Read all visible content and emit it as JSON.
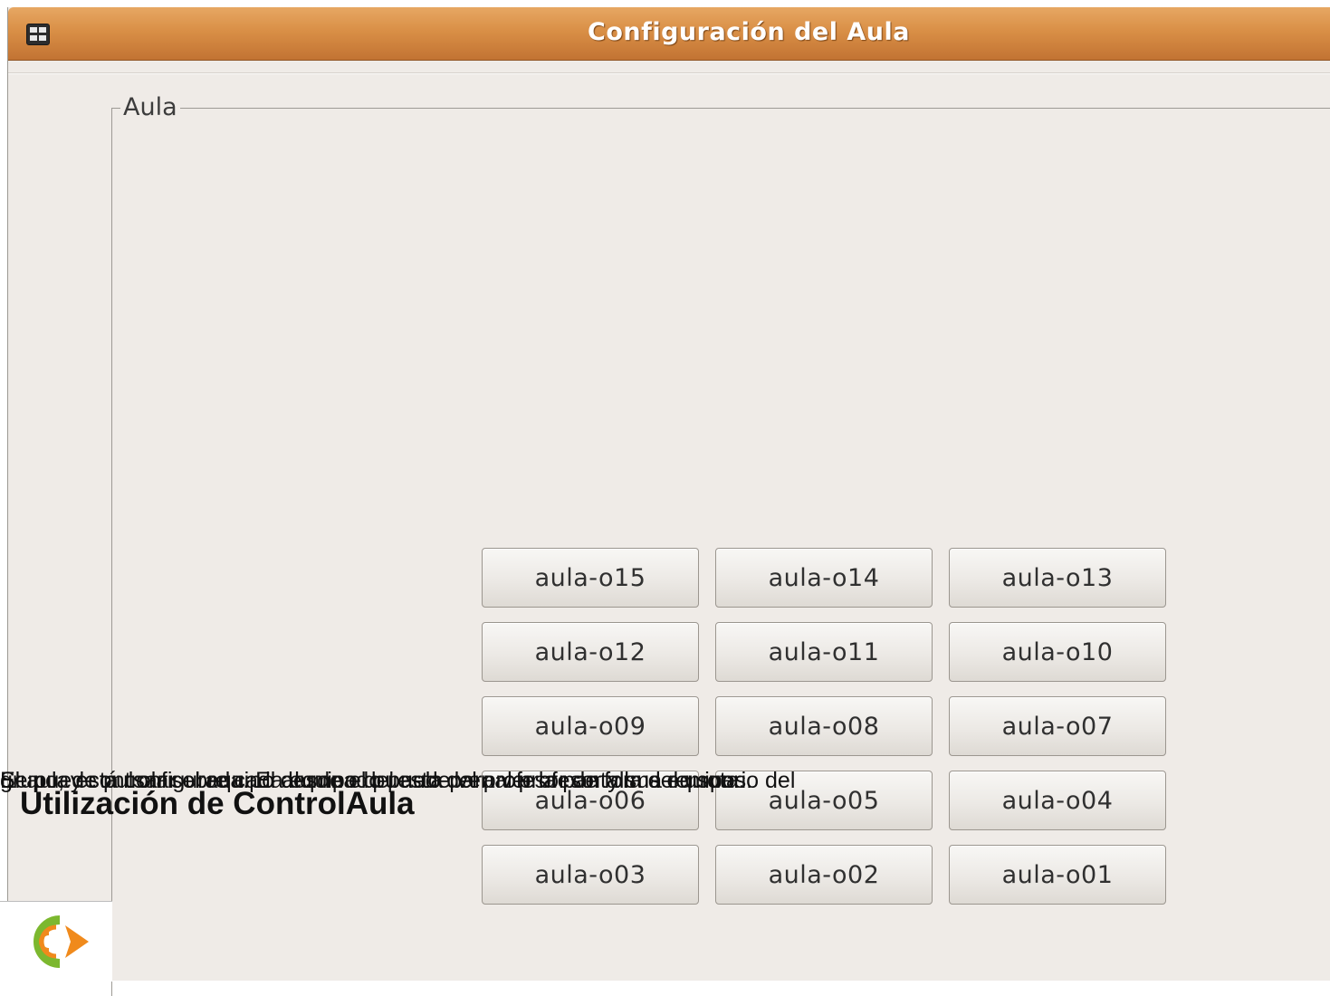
{
  "window": {
    "title": "Configuración del Aula",
    "icon": "window-menu-icon"
  },
  "frame": {
    "legend": "Aula"
  },
  "computers": [
    "aula-o15",
    "aula-o14",
    "aula-o13",
    "aula-o12",
    "aula-o11",
    "aula-o10",
    "aula-o09",
    "aula-o08",
    "aula-o07",
    "aula-o06",
    "aula-o05",
    "aula-o04",
    "aula-o03",
    "aula-o02",
    "aula-o01"
  ],
  "overlay": {
    "lines": [
      "El aula está configurada. El alumnado puede ver al profesor y sus equipos.",
      "Se puede pulsar sobre cada equipo del aula para ver la pantalla del usuario del",
      "grupo, y controlar el equipo desde el puesto del profesor de forma remota."
    ],
    "heading": "Utilización de ControlAula"
  },
  "logo": {
    "icon": "controlaula-logo-icon",
    "colors": {
      "orange": "#f08a1c",
      "green": "#7cb82f"
    }
  }
}
